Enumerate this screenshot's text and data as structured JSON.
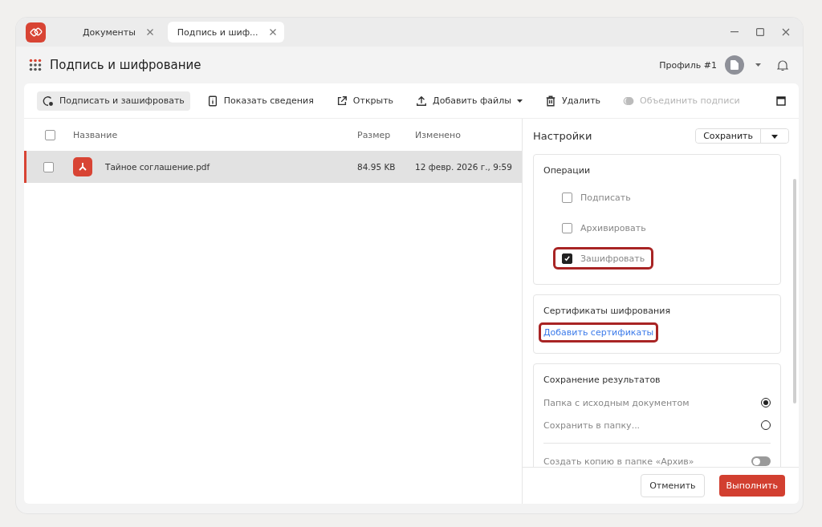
{
  "tabs": [
    {
      "label": "Документы",
      "selected": false
    },
    {
      "label": "Подпись и шиф...",
      "selected": true
    }
  ],
  "header": {
    "title": "Подпись и шифрование",
    "profile": "Профиль #1"
  },
  "toolbar": [
    {
      "label": "Подписать и зашифровать",
      "kind": "sign",
      "selected": true,
      "disabled": false
    },
    {
      "label": "Показать сведения",
      "kind": "info",
      "selected": false,
      "disabled": false
    },
    {
      "label": "Открыть",
      "kind": "open",
      "selected": false,
      "disabled": false
    },
    {
      "label": "Добавить файлы",
      "kind": "upload",
      "selected": false,
      "disabled": false
    },
    {
      "label": "Удалить",
      "kind": "delete",
      "selected": false,
      "disabled": false
    },
    {
      "label": "Объединить подписи",
      "kind": "merge",
      "selected": false,
      "disabled": true
    }
  ],
  "table": {
    "select_all": false,
    "columns": [
      "Название",
      "Размер",
      "Изменено"
    ],
    "rows": [
      {
        "name": "Тайное соглашение.pdf",
        "size": "84.95 KB",
        "modified": "12 февр. 2026 г., 9:59",
        "selected": true,
        "checked": false
      }
    ]
  },
  "settings": {
    "title": "Настройки",
    "save": "Сохранить",
    "operations": {
      "title": "Операции",
      "items": [
        {
          "label": "Подписать",
          "checked": false,
          "highlighted": false
        },
        {
          "label": "Архивировать",
          "checked": false,
          "highlighted": false
        },
        {
          "label": "Зашифровать",
          "checked": true,
          "highlighted": true
        }
      ]
    },
    "certificates": {
      "title": "Сертификаты шифрования",
      "link": "Добавить сертификаты",
      "highlighted": true
    },
    "output": {
      "title": "Сохранение результатов",
      "options": [
        {
          "label": "Папка с исходным документом",
          "selected": true
        },
        {
          "label": "Сохранить в папку...",
          "selected": false
        }
      ],
      "toggle": {
        "label": "Создать копию в папке «Архив»",
        "on": false
      }
    }
  },
  "footer": {
    "cancel": "Отменить",
    "run": "Выполнить"
  }
}
